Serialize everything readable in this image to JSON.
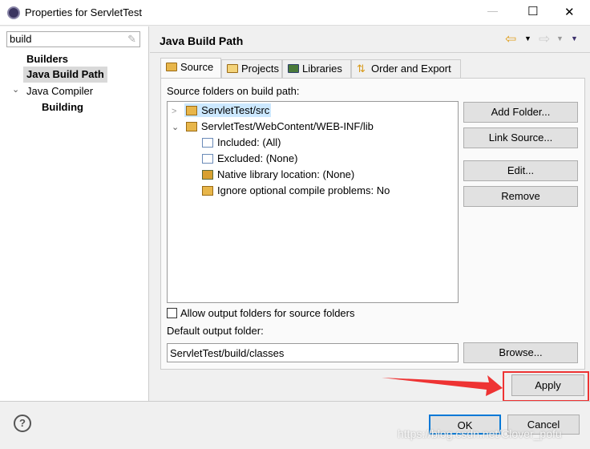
{
  "window": {
    "title": "Properties for ServletTest",
    "minimize": "—",
    "maximize": "☐",
    "close": "✕"
  },
  "sidebar": {
    "filter_value": "build",
    "items": [
      {
        "label": "Builders",
        "bold": true
      },
      {
        "label": "Java Build Path",
        "bold": true,
        "selected": true
      },
      {
        "label": "Java Compiler",
        "expanded": true
      },
      {
        "label": "Building",
        "bold": true
      }
    ]
  },
  "header": {
    "title": "Java Build Path",
    "back": "⇦",
    "forward": "⇨",
    "menu": "▾"
  },
  "tabs": [
    {
      "label": "Source",
      "active": true
    },
    {
      "label": "Projects"
    },
    {
      "label": "Libraries"
    },
    {
      "label": "Order and Export"
    }
  ],
  "source": {
    "label": "Source folders on build path:",
    "tree": [
      {
        "label": "ServletTest/src",
        "expanded": false,
        "selected": true
      },
      {
        "label": "ServletTest/WebContent/WEB-INF/lib",
        "expanded": true,
        "children": [
          {
            "label": "Included: (All)",
            "icon": "included-icon"
          },
          {
            "label": "Excluded: (None)",
            "icon": "excluded-icon"
          },
          {
            "label": "Native library location: (None)",
            "icon": "native-library-icon"
          },
          {
            "label": "Ignore optional compile problems: No",
            "icon": "ignore-problems-icon"
          }
        ]
      }
    ],
    "buttons": {
      "add_folder": "Add Folder...",
      "link_source": "Link Source...",
      "edit": "Edit...",
      "remove": "Remove"
    },
    "allow_output_label": "Allow output folders for source folders",
    "allow_output_checked": false,
    "default_output_label": "Default output folder:",
    "default_output_value": "ServletTest/build/classes",
    "browse": "Browse..."
  },
  "apply": "Apply",
  "footer": {
    "help": "?",
    "ok": "OK",
    "cancel": "Cancel"
  },
  "annotation": {
    "color": "#ee3333"
  },
  "watermark": "https://blog.csdn.net/Clover_pofu"
}
